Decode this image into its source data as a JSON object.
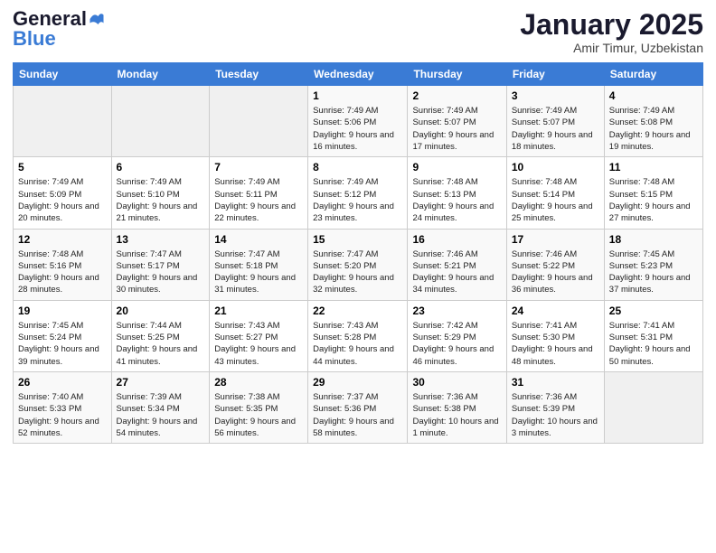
{
  "logo": {
    "line1": "General",
    "line2": "Blue"
  },
  "title": "January 2025",
  "subtitle": "Amir Timur, Uzbekistan",
  "days_of_week": [
    "Sunday",
    "Monday",
    "Tuesday",
    "Wednesday",
    "Thursday",
    "Friday",
    "Saturday"
  ],
  "weeks": [
    [
      {
        "day": "",
        "info": ""
      },
      {
        "day": "",
        "info": ""
      },
      {
        "day": "",
        "info": ""
      },
      {
        "day": "1",
        "info": "Sunrise: 7:49 AM\nSunset: 5:06 PM\nDaylight: 9 hours and 16 minutes."
      },
      {
        "day": "2",
        "info": "Sunrise: 7:49 AM\nSunset: 5:07 PM\nDaylight: 9 hours and 17 minutes."
      },
      {
        "day": "3",
        "info": "Sunrise: 7:49 AM\nSunset: 5:07 PM\nDaylight: 9 hours and 18 minutes."
      },
      {
        "day": "4",
        "info": "Sunrise: 7:49 AM\nSunset: 5:08 PM\nDaylight: 9 hours and 19 minutes."
      }
    ],
    [
      {
        "day": "5",
        "info": "Sunrise: 7:49 AM\nSunset: 5:09 PM\nDaylight: 9 hours and 20 minutes."
      },
      {
        "day": "6",
        "info": "Sunrise: 7:49 AM\nSunset: 5:10 PM\nDaylight: 9 hours and 21 minutes."
      },
      {
        "day": "7",
        "info": "Sunrise: 7:49 AM\nSunset: 5:11 PM\nDaylight: 9 hours and 22 minutes."
      },
      {
        "day": "8",
        "info": "Sunrise: 7:49 AM\nSunset: 5:12 PM\nDaylight: 9 hours and 23 minutes."
      },
      {
        "day": "9",
        "info": "Sunrise: 7:48 AM\nSunset: 5:13 PM\nDaylight: 9 hours and 24 minutes."
      },
      {
        "day": "10",
        "info": "Sunrise: 7:48 AM\nSunset: 5:14 PM\nDaylight: 9 hours and 25 minutes."
      },
      {
        "day": "11",
        "info": "Sunrise: 7:48 AM\nSunset: 5:15 PM\nDaylight: 9 hours and 27 minutes."
      }
    ],
    [
      {
        "day": "12",
        "info": "Sunrise: 7:48 AM\nSunset: 5:16 PM\nDaylight: 9 hours and 28 minutes."
      },
      {
        "day": "13",
        "info": "Sunrise: 7:47 AM\nSunset: 5:17 PM\nDaylight: 9 hours and 30 minutes."
      },
      {
        "day": "14",
        "info": "Sunrise: 7:47 AM\nSunset: 5:18 PM\nDaylight: 9 hours and 31 minutes."
      },
      {
        "day": "15",
        "info": "Sunrise: 7:47 AM\nSunset: 5:20 PM\nDaylight: 9 hours and 32 minutes."
      },
      {
        "day": "16",
        "info": "Sunrise: 7:46 AM\nSunset: 5:21 PM\nDaylight: 9 hours and 34 minutes."
      },
      {
        "day": "17",
        "info": "Sunrise: 7:46 AM\nSunset: 5:22 PM\nDaylight: 9 hours and 36 minutes."
      },
      {
        "day": "18",
        "info": "Sunrise: 7:45 AM\nSunset: 5:23 PM\nDaylight: 9 hours and 37 minutes."
      }
    ],
    [
      {
        "day": "19",
        "info": "Sunrise: 7:45 AM\nSunset: 5:24 PM\nDaylight: 9 hours and 39 minutes."
      },
      {
        "day": "20",
        "info": "Sunrise: 7:44 AM\nSunset: 5:25 PM\nDaylight: 9 hours and 41 minutes."
      },
      {
        "day": "21",
        "info": "Sunrise: 7:43 AM\nSunset: 5:27 PM\nDaylight: 9 hours and 43 minutes."
      },
      {
        "day": "22",
        "info": "Sunrise: 7:43 AM\nSunset: 5:28 PM\nDaylight: 9 hours and 44 minutes."
      },
      {
        "day": "23",
        "info": "Sunrise: 7:42 AM\nSunset: 5:29 PM\nDaylight: 9 hours and 46 minutes."
      },
      {
        "day": "24",
        "info": "Sunrise: 7:41 AM\nSunset: 5:30 PM\nDaylight: 9 hours and 48 minutes."
      },
      {
        "day": "25",
        "info": "Sunrise: 7:41 AM\nSunset: 5:31 PM\nDaylight: 9 hours and 50 minutes."
      }
    ],
    [
      {
        "day": "26",
        "info": "Sunrise: 7:40 AM\nSunset: 5:33 PM\nDaylight: 9 hours and 52 minutes."
      },
      {
        "day": "27",
        "info": "Sunrise: 7:39 AM\nSunset: 5:34 PM\nDaylight: 9 hours and 54 minutes."
      },
      {
        "day": "28",
        "info": "Sunrise: 7:38 AM\nSunset: 5:35 PM\nDaylight: 9 hours and 56 minutes."
      },
      {
        "day": "29",
        "info": "Sunrise: 7:37 AM\nSunset: 5:36 PM\nDaylight: 9 hours and 58 minutes."
      },
      {
        "day": "30",
        "info": "Sunrise: 7:36 AM\nSunset: 5:38 PM\nDaylight: 10 hours and 1 minute."
      },
      {
        "day": "31",
        "info": "Sunrise: 7:36 AM\nSunset: 5:39 PM\nDaylight: 10 hours and 3 minutes."
      },
      {
        "day": "",
        "info": ""
      }
    ]
  ]
}
